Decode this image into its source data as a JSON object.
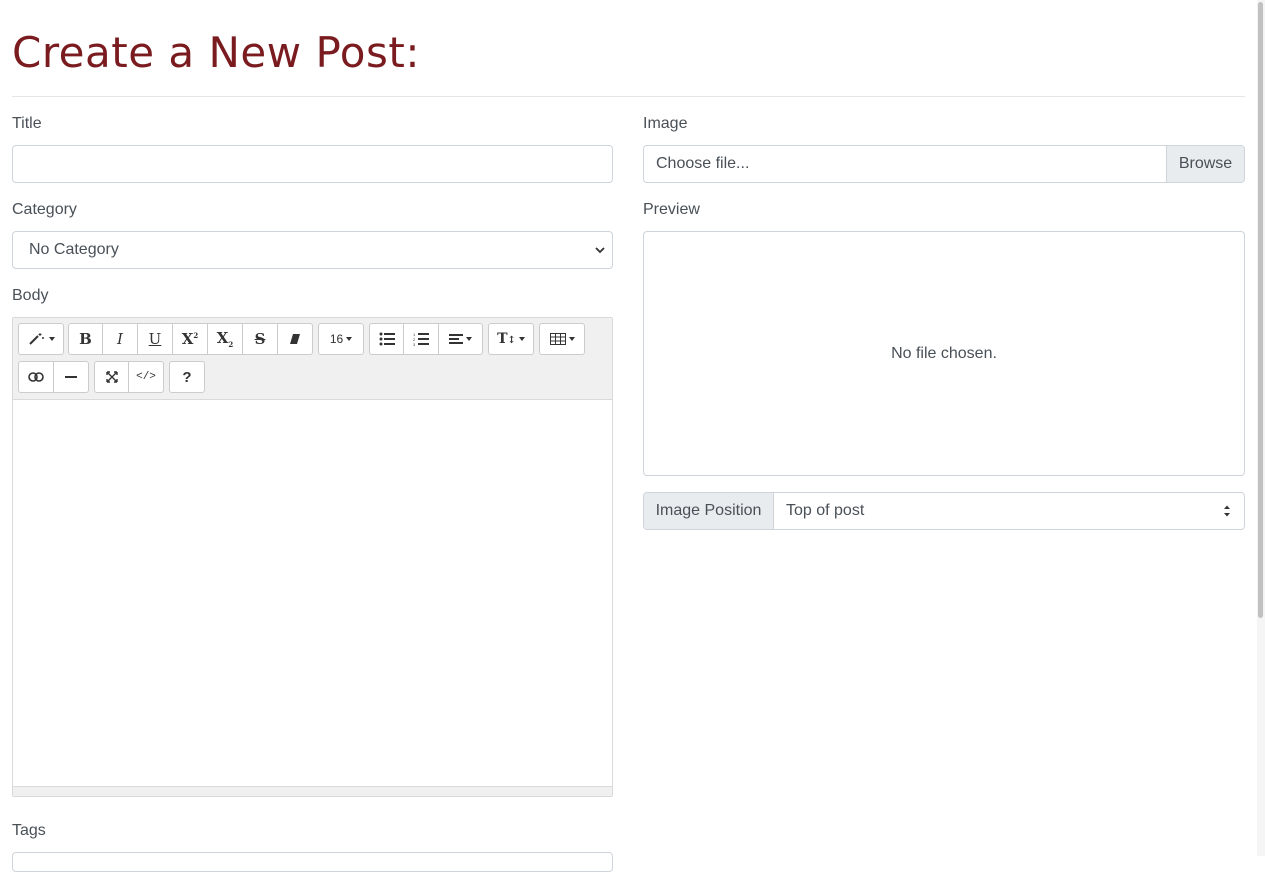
{
  "page": {
    "title": "Create a New Post:"
  },
  "form": {
    "title_label": "Title",
    "title_value": "",
    "category_label": "Category",
    "category_selected": "No Category",
    "body_label": "Body",
    "tags_label": "Tags"
  },
  "image": {
    "label": "Image",
    "file_placeholder": "Choose file...",
    "browse_label": "Browse",
    "preview_label": "Preview",
    "preview_text": "No file chosen.",
    "position_label": "Image Position",
    "position_selected": "Top of post"
  },
  "editor": {
    "font_size": "16",
    "help_label": "?",
    "toolbar": [
      "magic-wand-icon",
      "bold-icon",
      "italic-icon",
      "underline-icon",
      "superscript-icon",
      "subscript-icon",
      "strikethrough-icon",
      "eraser-icon",
      "font-size-dropdown",
      "unordered-list-icon",
      "ordered-list-icon",
      "align-icon",
      "text-height-icon",
      "table-icon",
      "link-icon",
      "horizontal-rule-icon",
      "fullscreen-icon",
      "code-view-icon",
      "help-icon"
    ]
  },
  "colors": {
    "title": "#7a1c1f",
    "text": "#495057",
    "border": "#ced4da",
    "addon_bg": "#e9ecef"
  }
}
